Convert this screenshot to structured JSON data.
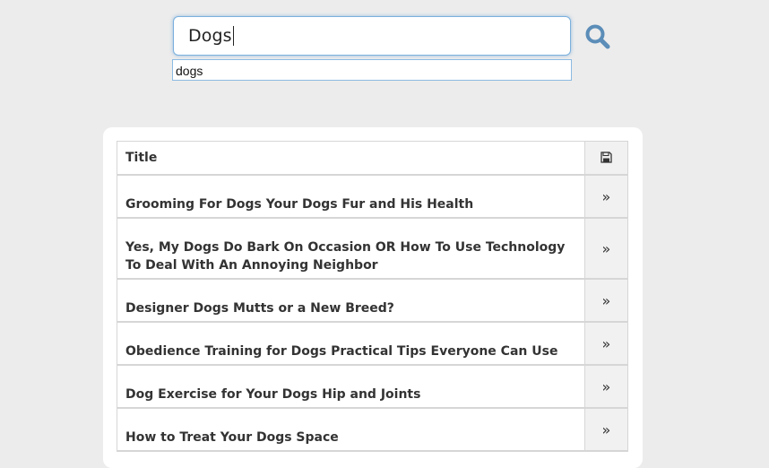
{
  "search": {
    "value": "Dogs",
    "suggestions": [
      "dogs"
    ]
  },
  "table": {
    "header_title": "Title",
    "save_icon": "floppy-disk-icon",
    "row_icon": "double-chevron-right-icon",
    "rows": [
      {
        "title": "Grooming For Dogs Your Dogs Fur and His Health"
      },
      {
        "title": "Yes, My Dogs Do Bark On Occasion OR How To Use Technology To Deal With An Annoying Neighbor"
      },
      {
        "title": "Designer Dogs Mutts or a New Breed?"
      },
      {
        "title": "Obedience Training for Dogs Practical Tips Everyone Can Use"
      },
      {
        "title": "Dog Exercise for Your Dogs Hip and Joints"
      },
      {
        "title": "How to Treat Your Dogs Space"
      }
    ]
  },
  "colors": {
    "page_bg": "#ececec",
    "search_border": "#7ab0dd",
    "search_icon": "#5b8db8"
  }
}
